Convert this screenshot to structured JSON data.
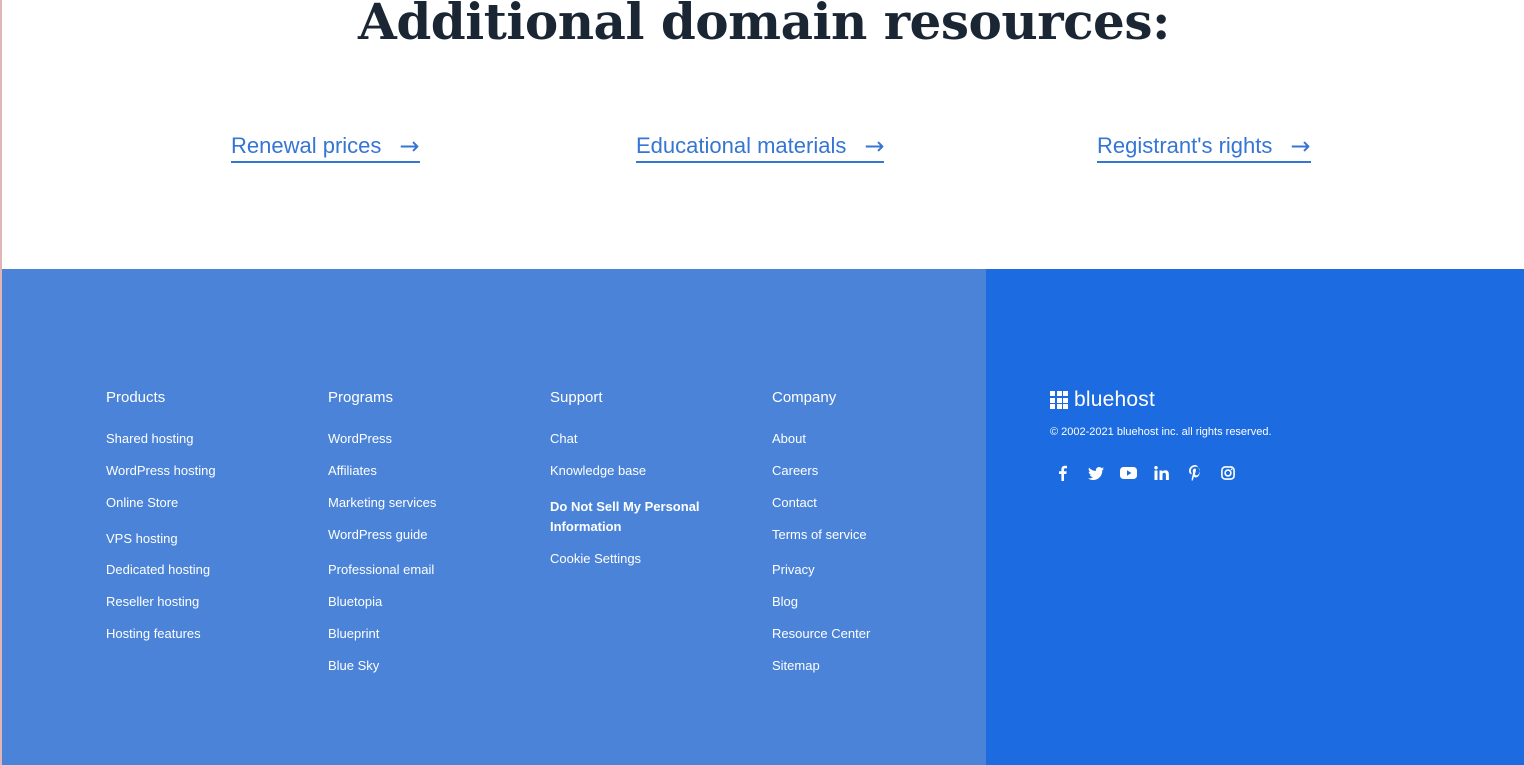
{
  "resources": {
    "title": "Additional domain resources:",
    "links": [
      {
        "label": "Renewal prices",
        "arrow": "→"
      },
      {
        "label": "Educational materials",
        "arrow": "→"
      },
      {
        "label": "Registrant's rights",
        "arrow": "→"
      }
    ]
  },
  "footer": {
    "columns": [
      {
        "heading": "Products",
        "links": [
          "Shared hosting",
          "WordPress hosting",
          "Online Store",
          "VPS hosting",
          "Dedicated hosting",
          "Reseller hosting",
          "Hosting features"
        ]
      },
      {
        "heading": "Programs",
        "links": [
          "WordPress",
          "Affiliates",
          "Marketing services",
          "WordPress guide",
          "Professional email",
          "Bluetopia",
          "Blueprint",
          "Blue Sky"
        ]
      },
      {
        "heading": "Support",
        "links": [
          "Chat",
          "Knowledge base",
          "Do Not Sell My Personal Information",
          "Cookie Settings"
        ]
      },
      {
        "heading": "Company",
        "links": [
          "About",
          "Careers",
          "Contact",
          "Terms of service",
          "Privacy",
          "Blog",
          "Resource Center",
          "Sitemap"
        ]
      }
    ],
    "brand": {
      "name": "bluehost",
      "copyright": "© 2002-2021 bluehost inc. all rights reserved."
    },
    "socials": [
      {
        "icon": "facebook-icon"
      },
      {
        "icon": "twitter-icon"
      },
      {
        "icon": "youtube-icon"
      },
      {
        "icon": "linkedin-icon"
      },
      {
        "icon": "pinterest-icon"
      },
      {
        "icon": "instagram-icon"
      }
    ]
  },
  "colors": {
    "heading": "#1b2635",
    "link_blue": "#3575d3",
    "footer_left": "#4a83d8",
    "footer_right": "#1c6be0"
  }
}
